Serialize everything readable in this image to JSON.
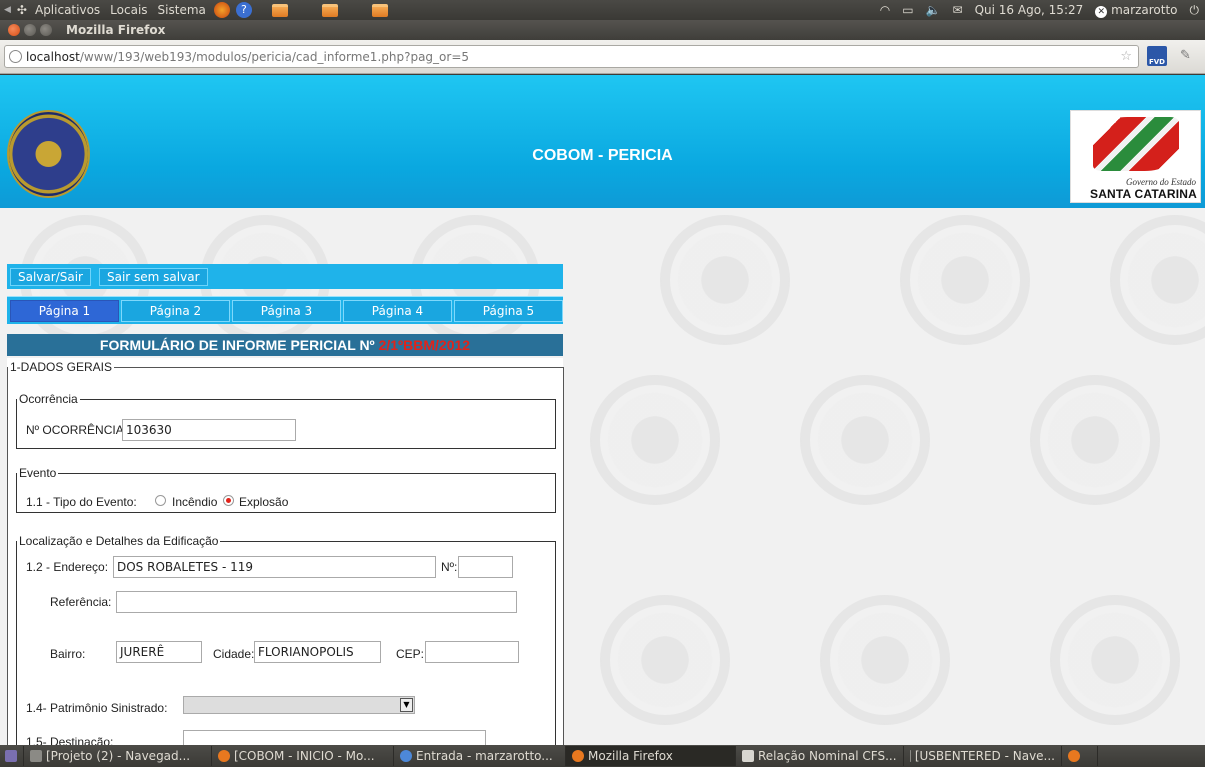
{
  "top_panel": {
    "menu_apps": "Aplicativos",
    "menu_places": "Locais",
    "menu_system": "Sistema",
    "clock": "Qui 16 Ago, 15:27",
    "user": "marzarotto"
  },
  "window": {
    "title": "Mozilla Firefox"
  },
  "nav": {
    "url_host": "localhost",
    "url_path": "/www/193/web193/modulos/pericia/cad_informe1.php?pag_or=5",
    "ext_label": "FVD"
  },
  "banner": {
    "title": "COBOM - PERICIA",
    "logo_small": "Governo do Estado",
    "logo_big": "SANTA CATARINA"
  },
  "actions": {
    "save_exit": "Salvar/Sair",
    "exit_nosave": "Sair sem salvar"
  },
  "tabs": [
    {
      "label": "Página 1"
    },
    {
      "label": "Página 2"
    },
    {
      "label": "Página 3"
    },
    {
      "label": "Página 4"
    },
    {
      "label": "Página 5"
    }
  ],
  "form": {
    "header_text": "FORMULÁRIO DE INFORME PERICIAL Nº",
    "header_number": "2/1ºBBM/2012",
    "section_main": "1-DADOS GERAIS",
    "ocorrencia": {
      "legend": "Ocorrência",
      "label": "Nº OCORRÊNCIA:",
      "value": "103630"
    },
    "evento": {
      "legend": "Evento",
      "label": "1.1 - Tipo do Evento:",
      "opt1": "Incêndio",
      "opt2": "Explosão",
      "selected": "Explosão"
    },
    "local": {
      "legend": "Localização e Detalhes da Edificação",
      "endereco_label": "1.2 - Endereço:",
      "endereco_value": "DOS ROBALETES - 119",
      "numero_label": "Nº:",
      "numero_value": "",
      "referencia_label": "Referência:",
      "referencia_value": "",
      "bairro_label": "Bairro:",
      "bairro_value": "JURERÊ INTER",
      "cidade_label": "Cidade:",
      "cidade_value": "FLORIANOPOLIS",
      "cep_label": "CEP:",
      "cep_value": "",
      "patrimonio_label": "1.4- Patrimônio Sinistrado:",
      "patrimonio_value": "",
      "destinacao_label": "1.5- Destinação:",
      "destinacao_value": ""
    }
  },
  "taskbar": [
    {
      "label": "[Projeto (2) - Navegad...",
      "active": false
    },
    {
      "label": "[COBOM - INICIO - Mo...",
      "active": false
    },
    {
      "label": "Entrada - marzarotto...",
      "active": false
    },
    {
      "label": "Mozilla Firefox",
      "active": true
    },
    {
      "label": "Relação Nominal CFS...",
      "active": false
    },
    {
      "label": "[USBENTERED - Nave...",
      "active": false
    }
  ]
}
